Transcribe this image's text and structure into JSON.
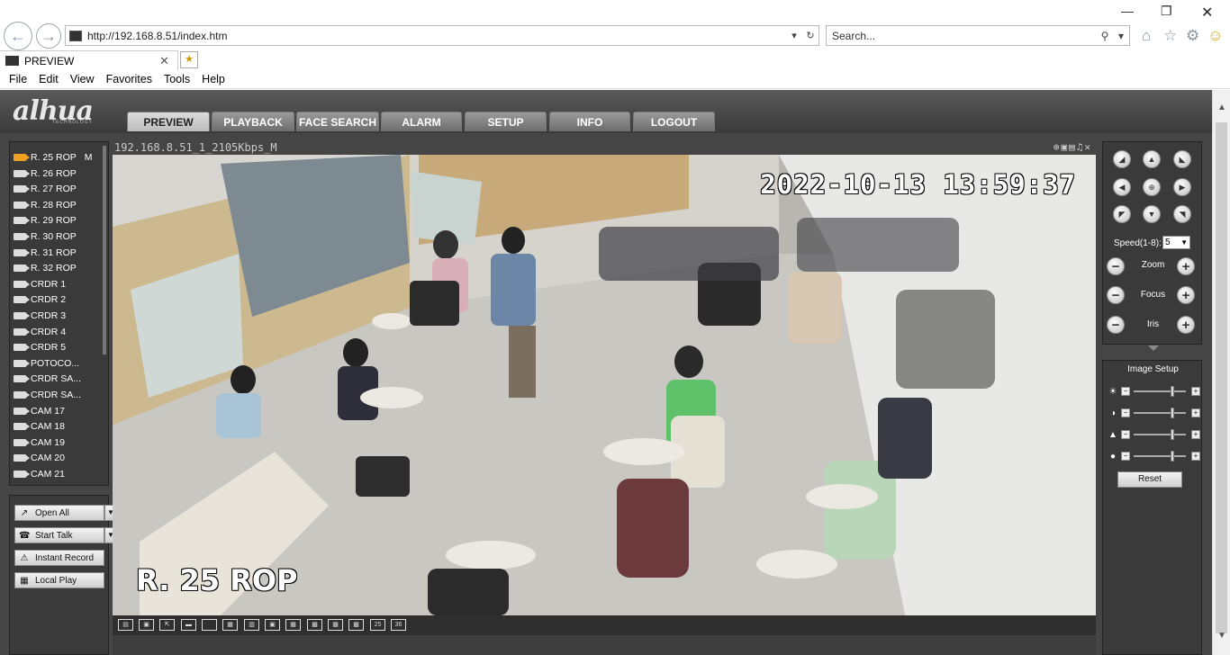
{
  "browser": {
    "address_url": "http://192.168.8.51/index.htm",
    "search_placeholder": "Search...",
    "tab_title": "PREVIEW",
    "menu": [
      "File",
      "Edit",
      "View",
      "Favorites",
      "Tools",
      "Help"
    ]
  },
  "app": {
    "logo": "alhua",
    "logo_sub": "TECHNOLOGY",
    "nav_tabs": [
      "PREVIEW",
      "PLAYBACK",
      "FACE SEARCH",
      "ALARM",
      "SETUP",
      "INFO",
      "LOGOUT"
    ],
    "active_tab": "PREVIEW"
  },
  "channels": [
    {
      "label": "R. 25 ROP",
      "suffix": "M",
      "active": true
    },
    {
      "label": "R. 26 ROP"
    },
    {
      "label": "R. 27 ROP"
    },
    {
      "label": "R. 28 ROP"
    },
    {
      "label": "R. 29 ROP"
    },
    {
      "label": "R. 30 ROP"
    },
    {
      "label": "R. 31 ROP"
    },
    {
      "label": "R. 32 ROP"
    },
    {
      "label": "CRDR 1"
    },
    {
      "label": "CRDR 2"
    },
    {
      "label": "CRDR 3"
    },
    {
      "label": "CRDR 4"
    },
    {
      "label": "CRDR 5"
    },
    {
      "label": "POTOCO..."
    },
    {
      "label": "CRDR SA..."
    },
    {
      "label": "CRDR SA..."
    },
    {
      "label": "CAM 17"
    },
    {
      "label": "CAM 18"
    },
    {
      "label": "CAM 19"
    },
    {
      "label": "CAM 20"
    },
    {
      "label": "CAM 21"
    }
  ],
  "actions": {
    "open_all": "Open All",
    "start_talk": "Start Talk",
    "instant_record": "Instant Record",
    "local_play": "Local Play"
  },
  "video": {
    "stream_info": "192.168.8.51_1_2105Kbps_M",
    "timestamp": "2022-10-13 13:59:37",
    "camera_name": "R. 25 ROP",
    "layout_labels": [
      "25",
      "36"
    ]
  },
  "ptz": {
    "speed_label": "Speed(1-8):",
    "speed_value": "5",
    "zoom_label": "Zoom",
    "focus_label": "Focus",
    "iris_label": "Iris"
  },
  "image_setup": {
    "title": "Image Setup",
    "reset_label": "Reset",
    "sliders": [
      {
        "icon": "brightness-icon",
        "level": 0.75
      },
      {
        "icon": "contrast-icon",
        "level": 0.75
      },
      {
        "icon": "saturation-icon",
        "level": 0.75
      },
      {
        "icon": "hue-icon",
        "level": 0.75
      }
    ]
  }
}
